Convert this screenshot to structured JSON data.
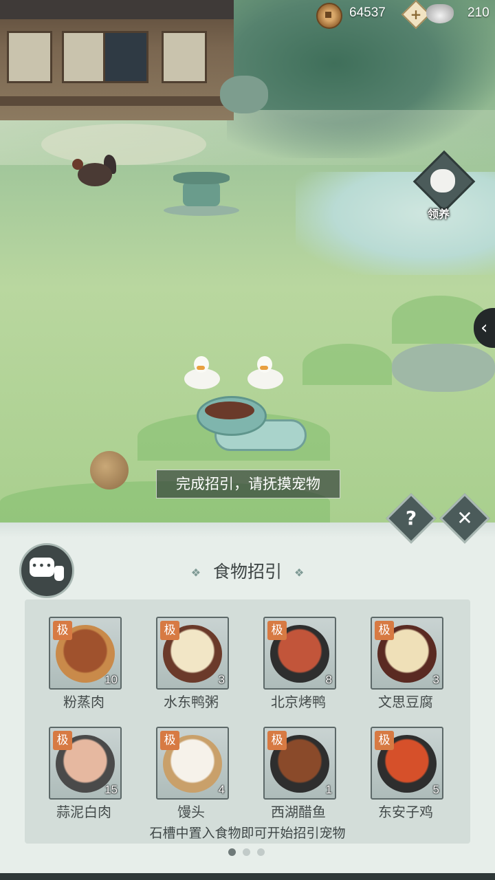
{
  "currency": {
    "coins": "64537",
    "ingots": "210",
    "coin_icon": "copper-coin-icon",
    "ingot_icon": "silver-ingot-icon",
    "plus_label": "+"
  },
  "side": {
    "adopt_label": "领养",
    "collapse_arrow": "‹"
  },
  "hint_text": "完成招引，请抚摸宠物",
  "panel": {
    "help_label": "?",
    "close_label": "✕",
    "title": "食物招引",
    "title_deco": "❖",
    "chat_dots": "•••",
    "tip": "石槽中置入食物即可开始招引宠物",
    "page_count": 3,
    "active_page": 1,
    "foods": [
      {
        "name": "粉蒸肉",
        "count": "10",
        "rank": "极",
        "plate": "#c98a4a",
        "dish": "#a0522d"
      },
      {
        "name": "水东鸭粥",
        "count": "3",
        "rank": "极",
        "plate": "#6b3a2a",
        "dish": "#f2e6c6"
      },
      {
        "name": "北京烤鸭",
        "count": "8",
        "rank": "极",
        "plate": "#2e2e2e",
        "dish": "#c2553a"
      },
      {
        "name": "文思豆腐",
        "count": "3",
        "rank": "极",
        "plate": "#5a2a22",
        "dish": "#efe0b8"
      },
      {
        "name": "蒜泥白肉",
        "count": "15",
        "rank": "极",
        "plate": "#4a4a4a",
        "dish": "#e6b8a0"
      },
      {
        "name": "馒头",
        "count": "4",
        "rank": "极",
        "plate": "#c9a06a",
        "dish": "#f6f2ea"
      },
      {
        "name": "西湖醋鱼",
        "count": "1",
        "rank": "极",
        "plate": "#2e2e2e",
        "dish": "#8a4a2a"
      },
      {
        "name": "东安子鸡",
        "count": "5",
        "rank": "极",
        "plate": "#2e2e2e",
        "dish": "#d6502a"
      }
    ]
  }
}
